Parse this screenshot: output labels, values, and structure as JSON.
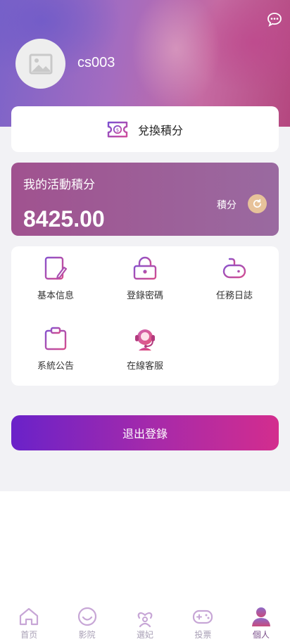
{
  "profile": {
    "username": "cs003"
  },
  "redeem": {
    "label": "兌換積分"
  },
  "points": {
    "title": "我的活動積分",
    "value": "8425.00",
    "unit": "積分"
  },
  "menu": {
    "items": [
      {
        "label": "基本信息",
        "icon": "edit-document-icon"
      },
      {
        "label": "登錄密碼",
        "icon": "lock-icon"
      },
      {
        "label": "任務日誌",
        "icon": "gamepad-icon"
      },
      {
        "label": "系統公告",
        "icon": "clipboard-icon"
      },
      {
        "label": "在線客服",
        "icon": "headset-icon"
      }
    ]
  },
  "logout": {
    "label": "退出登錄"
  },
  "tabbar": {
    "items": [
      {
        "label": "首页",
        "icon": "home-icon"
      },
      {
        "label": "影院",
        "icon": "smile-icon"
      },
      {
        "label": "選妃",
        "icon": "heart-person-icon"
      },
      {
        "label": "投票",
        "icon": "gamepad-icon"
      },
      {
        "label": "個人",
        "icon": "user-icon",
        "active": true
      }
    ]
  },
  "colors": {
    "accent_purple": "#9b59b6",
    "points_card": "#a0528f",
    "refresh_button": "#e7c29a",
    "logout_start": "#6a22c9",
    "logout_end": "#d32d8e"
  }
}
